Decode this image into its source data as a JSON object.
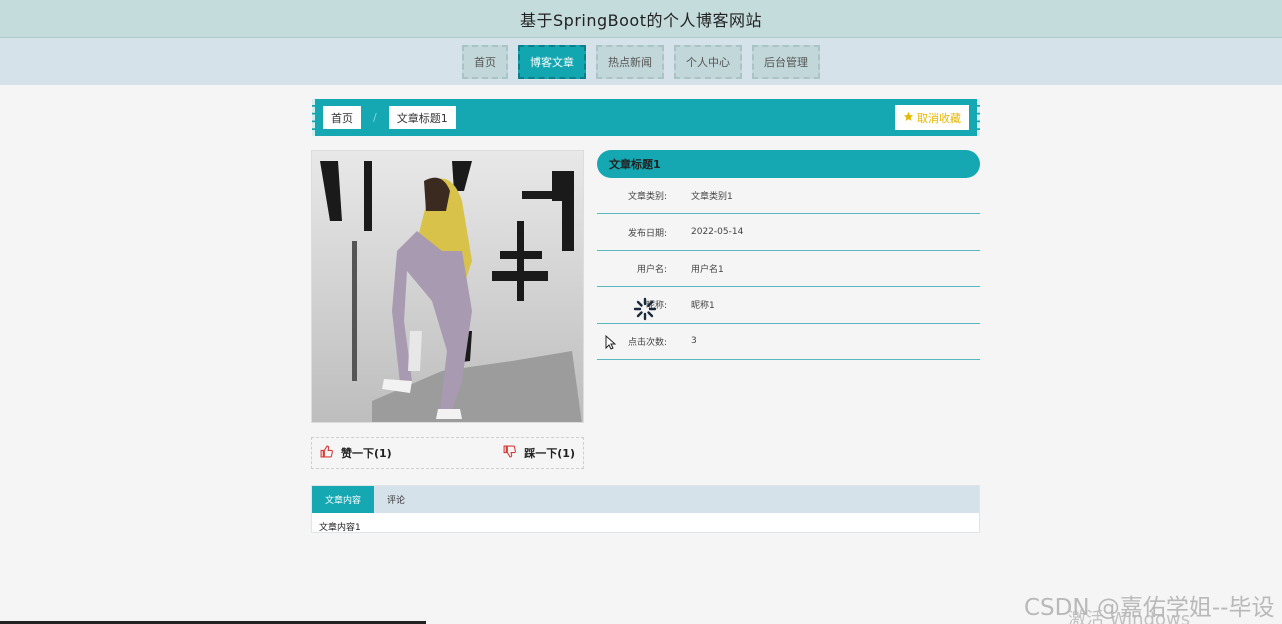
{
  "header": {
    "title": "基于SpringBoot的个人博客网站"
  },
  "nav": {
    "items": [
      {
        "label": "首页"
      },
      {
        "label": "博客文章"
      },
      {
        "label": "热点新闻"
      },
      {
        "label": "个人中心"
      },
      {
        "label": "后台管理"
      }
    ],
    "active_index": 1
  },
  "breadcrumb": {
    "home": "首页",
    "separator": "/",
    "current": "文章标题1",
    "fav_label": "取消收藏"
  },
  "cover": {
    "alt_icon": "cover-photo"
  },
  "vote": {
    "like_label": "赞一下(1)",
    "dislike_label": "踩一下(1)"
  },
  "article": {
    "title": "文章标题1",
    "fields": [
      {
        "label": "文章类别:",
        "value": "文章类别1"
      },
      {
        "label": "发布日期:",
        "value": "2022-05-14"
      },
      {
        "label": "用户名:",
        "value": "用户名1"
      },
      {
        "label": "昵称:",
        "value": "昵称1"
      },
      {
        "label": "点击次数:",
        "value": "3"
      }
    ]
  },
  "tabs": {
    "items": [
      {
        "label": "文章内容"
      },
      {
        "label": "评论"
      }
    ],
    "content": "文章内容1"
  },
  "watermarks": {
    "csdn": "CSDN @嘉佑学姐--毕设",
    "windows": "激活 Windows"
  },
  "colors": {
    "accent": "#15a8b3",
    "fav": "#e6b800",
    "vote_icon": "#d63b3b"
  }
}
